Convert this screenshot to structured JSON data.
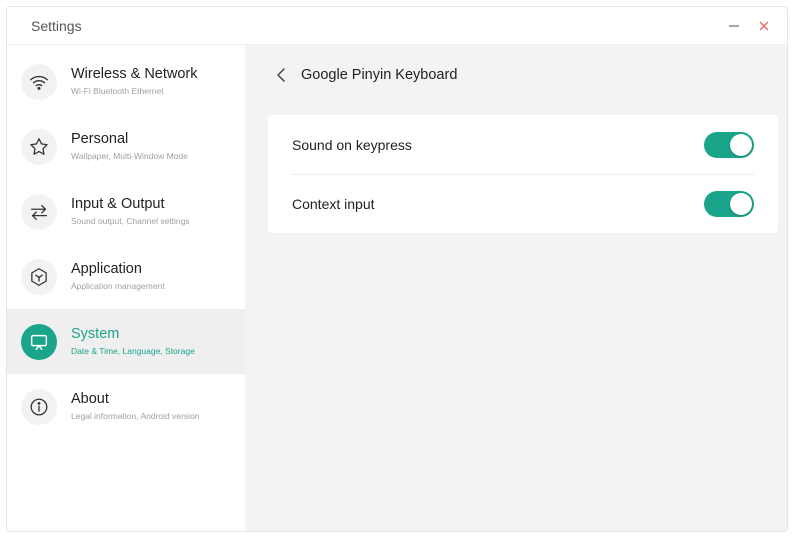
{
  "window": {
    "title": "Settings",
    "minimize_label": "−",
    "close_label": "×"
  },
  "colors": {
    "accent": "#1aa58a",
    "close": "#e46a6a"
  },
  "sidebar": {
    "items": [
      {
        "label": "Wireless & Network",
        "sub": "Wi-Fi Bluetooth Ethernet",
        "icon": "wifi-icon",
        "active": false
      },
      {
        "label": "Personal",
        "sub": "Wallpaper, Multi-Window Mode",
        "icon": "star-icon",
        "active": false
      },
      {
        "label": "Input & Output",
        "sub": "Sound output, Channel settings",
        "icon": "swap-arrows-icon",
        "active": false
      },
      {
        "label": "Application",
        "sub": "Application management",
        "icon": "hexagon-icon",
        "active": false
      },
      {
        "label": "System",
        "sub": "Date & Time, Language, Storage",
        "icon": "monitor-icon",
        "active": true
      },
      {
        "label": "About",
        "sub": "Legal information, Android version",
        "icon": "info-icon",
        "active": false
      }
    ]
  },
  "main": {
    "title": "Google Pinyin Keyboard",
    "settings": [
      {
        "label": "Sound on keypress",
        "enabled": true
      },
      {
        "label": "Context input",
        "enabled": true
      }
    ]
  }
}
